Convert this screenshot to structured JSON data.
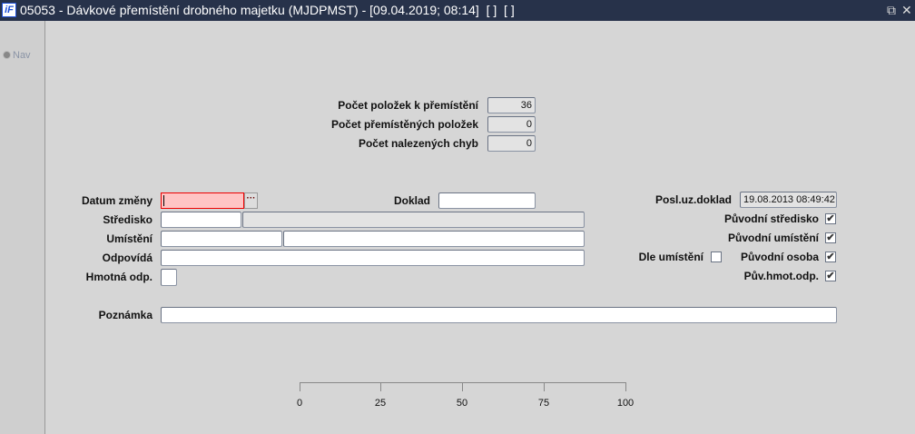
{
  "window": {
    "title": "05053 - Dávkové přemístění drobného majetku (MJDPMST) - [09.04.2019; 08:14]  [ ]  [ ]",
    "logo": "iF",
    "restore_icon": "restore-icon",
    "close_icon": "close-icon"
  },
  "sidebar": {
    "nav_label": "Nav"
  },
  "counts": [
    {
      "label": "Počet položek k přemístění",
      "value": "36"
    },
    {
      "label": "Počet přemístěných položek",
      "value": "0"
    },
    {
      "label": "Počet nalezených chyb",
      "value": "0"
    }
  ],
  "form": {
    "datum_zmeny": {
      "label": "Datum změny",
      "value": "",
      "button": "···"
    },
    "doklad": {
      "label": "Doklad",
      "value": ""
    },
    "posl_uz_doklad": {
      "label": "Posl.uz.doklad",
      "value": "19.08.2013 08:49:42"
    },
    "stredisko": {
      "label": "Středisko",
      "value": "",
      "name": ""
    },
    "umisteni": {
      "label": "Umístění",
      "value": "",
      "name": ""
    },
    "odpovida": {
      "label": "Odpovídá",
      "value": ""
    },
    "hmotna_odp": {
      "label": "Hmotná odp.",
      "value": ""
    },
    "poznamka": {
      "label": "Poznámka",
      "value": ""
    },
    "dle_umisteni": {
      "label": "Dle umístění",
      "checked": false
    },
    "puvodni_stredisko": {
      "label": "Původní středisko",
      "checked": true
    },
    "puvodni_umisteni": {
      "label": "Původní umístění",
      "checked": true
    },
    "puvodni_osoba": {
      "label": "Původní osoba",
      "checked": true
    },
    "puv_hmot_odp": {
      "label": "Pův.hmot.odp.",
      "checked": true
    }
  },
  "progress": {
    "value": 0,
    "ticks": [
      "0",
      "25",
      "50",
      "75",
      "100"
    ]
  }
}
